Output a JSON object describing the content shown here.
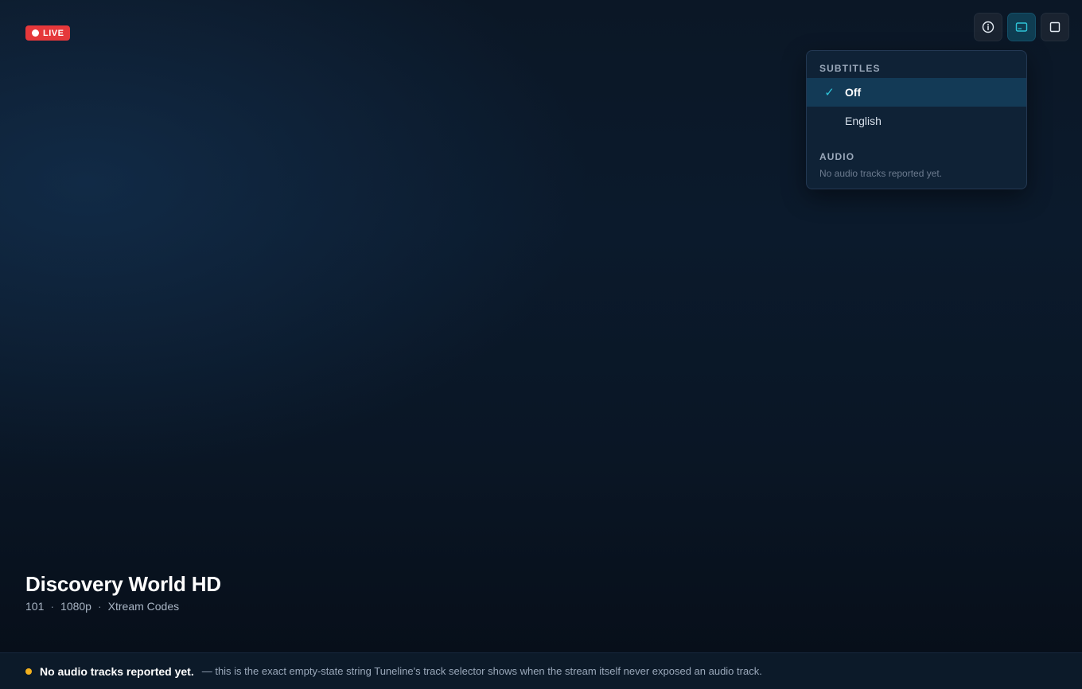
{
  "badge": {
    "label": "LIVE",
    "color": "#e5383b"
  },
  "controls": [
    {
      "name": "info-icon",
      "active": false
    },
    {
      "name": "subtitles-icon",
      "active": true
    },
    {
      "name": "fullscreen-icon",
      "active": false
    }
  ],
  "track_menu": {
    "subtitles_title": "SUBTITLES",
    "subtitles": [
      {
        "label": "Off",
        "selected": true,
        "check": "✓"
      },
      {
        "label": "English",
        "selected": false
      }
    ],
    "audio_title": "AUDIO",
    "audio_empty": "No audio tracks reported yet."
  },
  "channel": {
    "title": "Discovery World HD",
    "number": "101",
    "resolution": "1080p",
    "source": "Xtream Codes",
    "separator": "·"
  },
  "status_bar": {
    "strong": "No audio tracks reported yet.",
    "note": "— this is the exact empty-state string Tuneline's track selector shows when the stream itself never exposed an audio track.",
    "dot_color": "#f2b01e"
  },
  "colors": {
    "accent": "#2ec4d8"
  }
}
